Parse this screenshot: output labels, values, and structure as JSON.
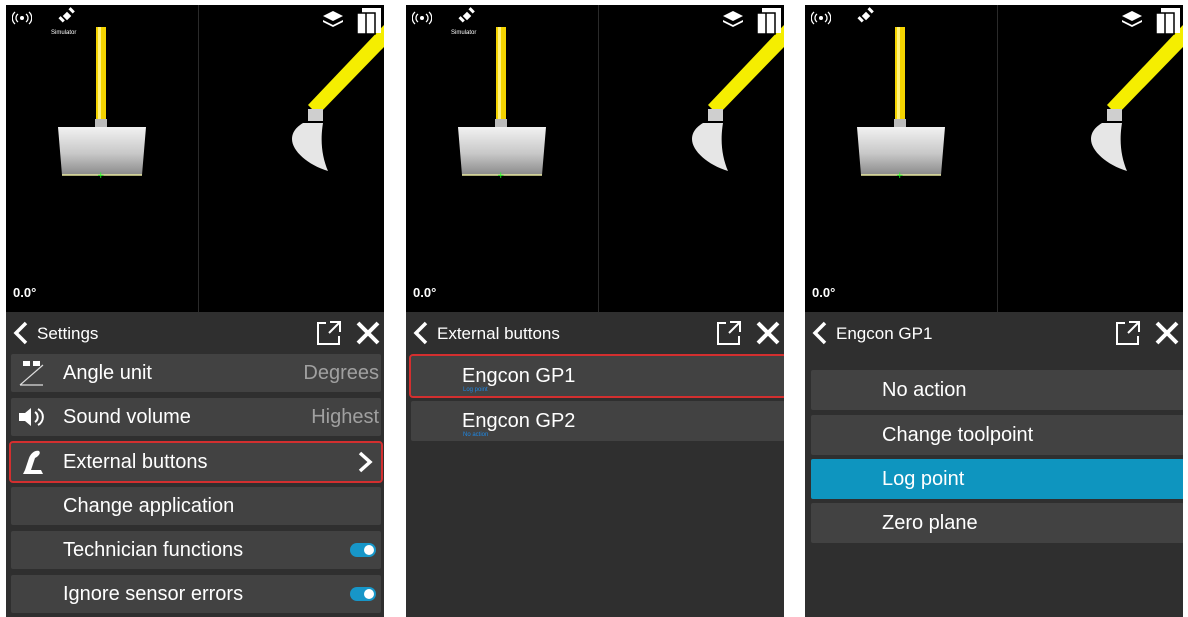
{
  "panels": [
    {
      "status": {
        "simulator_label": "Simulator",
        "angle": "0.0°"
      },
      "header": {
        "title": "Settings"
      },
      "settings_rows": [
        {
          "label": "Angle unit",
          "value": "Degrees",
          "icon": "angle-unit-icon"
        },
        {
          "label": "Sound volume",
          "value": "Highest",
          "icon": "speaker-icon"
        },
        {
          "label": "External buttons",
          "value": "",
          "icon": "joystick-icon"
        },
        {
          "label": "Change application",
          "value": ""
        },
        {
          "label": "Technician functions",
          "value": "",
          "toggle": true
        },
        {
          "label": "Ignore sensor errors",
          "value": "",
          "toggle": true
        }
      ]
    },
    {
      "status": {
        "simulator_label": "Simulator",
        "angle": "0.0°"
      },
      "header": {
        "title": "External buttons"
      },
      "buttons": [
        {
          "label": "Engcon GP1",
          "sub": "Log point"
        },
        {
          "label": "Engcon GP2",
          "sub": "No action"
        }
      ]
    },
    {
      "status": {
        "angle": "0.0°"
      },
      "header": {
        "title": "Engcon GP1"
      },
      "actions": [
        {
          "label": "No action",
          "selected": false
        },
        {
          "label": "Change toolpoint",
          "selected": false
        },
        {
          "label": "Log point",
          "selected": true
        },
        {
          "label": "Zero plane",
          "selected": false
        }
      ]
    }
  ],
  "colors": {
    "accent": "#0e95bf",
    "highlight": "#d32f2f",
    "boom": "#f5d400"
  }
}
